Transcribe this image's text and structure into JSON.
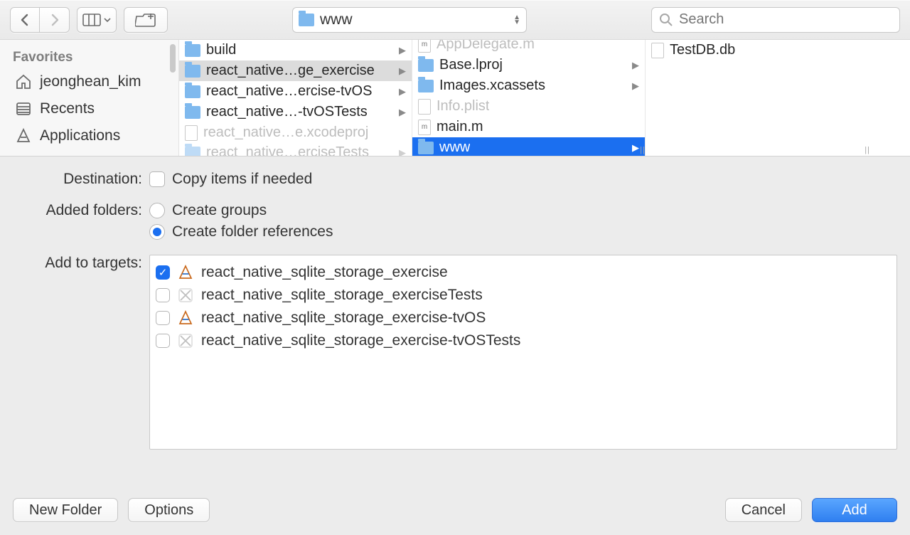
{
  "toolbar": {
    "path_label": "www",
    "search_placeholder": "Search"
  },
  "sidebar": {
    "header": "Favorites",
    "items": [
      {
        "label": "jeonghean_kim",
        "icon": "home-icon"
      },
      {
        "label": "Recents",
        "icon": "recents-icon"
      },
      {
        "label": "Applications",
        "icon": "applications-icon"
      }
    ]
  },
  "columns": {
    "c1": [
      {
        "label": "build",
        "type": "folder",
        "hasChildren": true
      },
      {
        "label": "react_native…ge_exercise",
        "type": "folder",
        "hasChildren": true,
        "selected": "grey"
      },
      {
        "label": "react_native…ercise-tvOS",
        "type": "folder",
        "hasChildren": true
      },
      {
        "label": "react_native…-tvOSTests",
        "type": "folder",
        "hasChildren": true
      },
      {
        "label": "react_native…e.xcodeproj",
        "type": "file-dim"
      },
      {
        "label": "react_native…erciseTests",
        "type": "folder-dim",
        "hasChildren": true
      }
    ],
    "c2": [
      {
        "label": "AppDelegate.m",
        "type": "file-m",
        "dim": true
      },
      {
        "label": "Base.lproj",
        "type": "folder",
        "hasChildren": true
      },
      {
        "label": "Images.xcassets",
        "type": "folder",
        "hasChildren": true
      },
      {
        "label": "Info.plist",
        "type": "file-dim"
      },
      {
        "label": "main.m",
        "type": "file-m"
      },
      {
        "label": "www",
        "type": "folder",
        "hasChildren": true,
        "selected": "blue"
      }
    ],
    "c3": [
      {
        "label": "TestDB.db",
        "type": "file"
      }
    ]
  },
  "form": {
    "destination_label": "Destination:",
    "copy_items_label": "Copy items if needed",
    "copy_items_checked": false,
    "added_folders_label": "Added folders:",
    "radio_groups_label": "Create groups",
    "radio_refs_label": "Create folder references",
    "radio_selected": "refs",
    "targets_label": "Add to targets:",
    "targets": [
      {
        "label": "react_native_sqlite_storage_exercise",
        "checked": true,
        "icon": "app"
      },
      {
        "label": "react_native_sqlite_storage_exerciseTests",
        "checked": false,
        "icon": "tests"
      },
      {
        "label": "react_native_sqlite_storage_exercise-tvOS",
        "checked": false,
        "icon": "app"
      },
      {
        "label": "react_native_sqlite_storage_exercise-tvOSTests",
        "checked": false,
        "icon": "tests"
      }
    ]
  },
  "buttons": {
    "new_folder": "New Folder",
    "options": "Options",
    "cancel": "Cancel",
    "add": "Add"
  }
}
